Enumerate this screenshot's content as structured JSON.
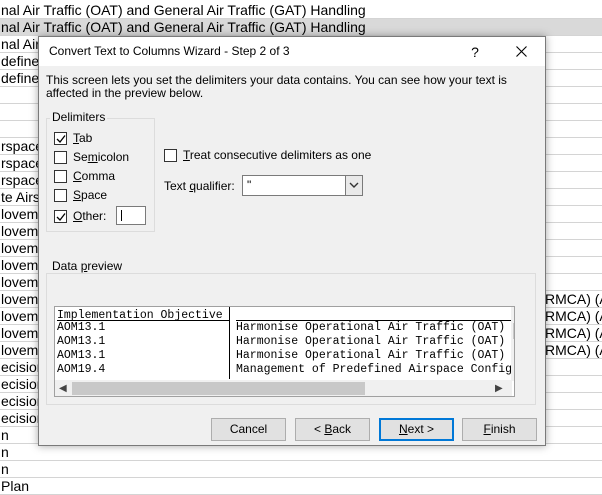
{
  "sheet": {
    "rows": [
      {
        "left": "nal Air Traffic (OAT) and General Air Traffic (GAT) Handling",
        "right": "",
        "gray": false
      },
      {
        "left": "nal Air Traffic (OAT) and General Air Traffic (GAT) Handling",
        "right": "",
        "gray": true
      },
      {
        "left": "nal Air",
        "right": "",
        "gray": false
      },
      {
        "left": "defined",
        "right": "",
        "gray": false
      },
      {
        "left": "defined",
        "right": "",
        "gray": false
      },
      {
        "left": "",
        "right": "",
        "gray": false
      },
      {
        "left": "",
        "right": "",
        "gray": false
      },
      {
        "left": "",
        "right": "",
        "gray": false
      },
      {
        "left": "rspace",
        "right": "",
        "gray": false
      },
      {
        "left": "rspace",
        "right": "",
        "gray": false
      },
      {
        "left": "rspace",
        "right": "",
        "gray": false
      },
      {
        "left": "te Airs",
        "right": "",
        "gray": false
      },
      {
        "left": "loveme",
        "right": "",
        "gray": false
      },
      {
        "left": "loveme",
        "right": "",
        "gray": false
      },
      {
        "left": "loveme",
        "right": "",
        "gray": false
      },
      {
        "left": "loveme",
        "right": "",
        "gray": false
      },
      {
        "left": "loveme",
        "right": "",
        "gray": false
      },
      {
        "left": "loveme",
        "right": "RMCA) (A",
        "gray": false
      },
      {
        "left": "loveme",
        "right": "RMCA) (A",
        "gray": false
      },
      {
        "left": "loveme",
        "right": "RMCA) (A",
        "gray": false
      },
      {
        "left": "loveme",
        "right": "RMCA) (A",
        "gray": false
      },
      {
        "left": "ecision",
        "right": "",
        "gray": false
      },
      {
        "left": "ecision",
        "right": "",
        "gray": false
      },
      {
        "left": "ecision",
        "right": "",
        "gray": false
      },
      {
        "left": "ecision",
        "right": "",
        "gray": false
      },
      {
        "left": "n",
        "right": "",
        "gray": false
      },
      {
        "left": "n",
        "right": "",
        "gray": false
      },
      {
        "left": "n",
        "right": "",
        "gray": false
      },
      {
        "left": "Plan",
        "right": "",
        "gray": false
      }
    ]
  },
  "dialog": {
    "title": "Convert Text to Columns Wizard - Step 2 of 3",
    "help_label": "?",
    "description": "This screen lets you set the delimiters your data contains.  You can see how your text is affected in the preview below.",
    "delimiters": {
      "title": "Delimiters",
      "tab": {
        "pre": "",
        "key": "T",
        "post": "ab",
        "checked": true
      },
      "semicolon": {
        "pre": "Se",
        "key": "m",
        "post": "icolon",
        "checked": false
      },
      "comma": {
        "pre": "",
        "key": "C",
        "post": "omma",
        "checked": false
      },
      "space": {
        "pre": "",
        "key": "S",
        "post": "pace",
        "checked": false
      },
      "other": {
        "pre": "",
        "key": "O",
        "post": "ther:",
        "checked": true,
        "value": ""
      }
    },
    "consecutive": {
      "pre": "",
      "key": "T",
      "post": "reat consecutive delimiters as one",
      "checked": false
    },
    "qualifier": {
      "pre": "Text ",
      "key": "q",
      "post": "ualifier:",
      "value": "\""
    },
    "preview": {
      "title": "Data ",
      "title_key": "p",
      "title_post": "review",
      "col1": [
        "Implementation Objective",
        "AOM13.1",
        "AOM13.1",
        "AOM13.1",
        "AOM19.4"
      ],
      "col2": [
        "",
        "Harmonise Operational Air Traffic (OAT)",
        "Harmonise Operational Air Traffic (OAT)",
        "Harmonise Operational Air Traffic (OAT)",
        "Management of Predefined Airspace Config"
      ]
    },
    "buttons": {
      "cancel": "Cancel",
      "back": {
        "pre": "< ",
        "key": "B",
        "post": "ack"
      },
      "next": {
        "pre": "",
        "key": "N",
        "post": "ext >"
      },
      "finish": {
        "pre": "",
        "key": "F",
        "post": "inish"
      }
    }
  }
}
